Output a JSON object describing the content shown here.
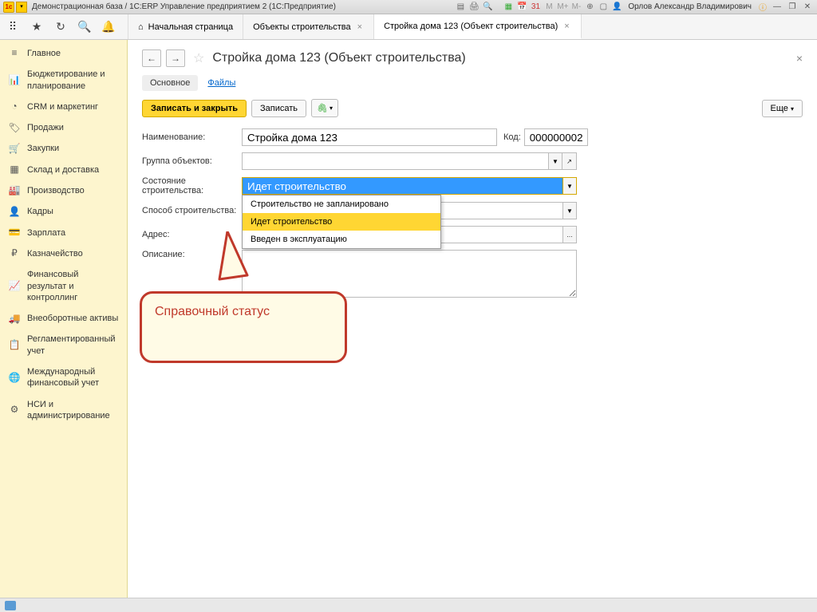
{
  "titlebar": {
    "title": "Демонстрационная база / 1С:ERP Управление предприятием 2  (1С:Предприятие)",
    "user": "Орлов Александр Владимирович"
  },
  "tabs": {
    "home": "Начальная страница",
    "t1": "Объекты строительства",
    "t2": "Стройка дома 123 (Объект строительства)"
  },
  "sidebar": [
    {
      "label": "Главное",
      "icon": "≡"
    },
    {
      "label": "Бюджетирование и планирование",
      "icon": "📊"
    },
    {
      "label": "CRM и маркетинг",
      "icon": "◔"
    },
    {
      "label": "Продажи",
      "icon": "🏷"
    },
    {
      "label": "Закупки",
      "icon": "🛒"
    },
    {
      "label": "Склад и доставка",
      "icon": "▦"
    },
    {
      "label": "Производство",
      "icon": "🏭"
    },
    {
      "label": "Кадры",
      "icon": "👤"
    },
    {
      "label": "Зарплата",
      "icon": "💳"
    },
    {
      "label": "Казначейство",
      "icon": "₽"
    },
    {
      "label": "Финансовый результат и контроллинг",
      "icon": "📈"
    },
    {
      "label": "Внеоборотные активы",
      "icon": "🚚"
    },
    {
      "label": "Регламентированный учет",
      "icon": "📋"
    },
    {
      "label": "Международный финансовый учет",
      "icon": "🌐"
    },
    {
      "label": "НСИ и администрирование",
      "icon": "⚙"
    }
  ],
  "page": {
    "title": "Стройка дома 123 (Объект строительства)",
    "subtab_main": "Основное",
    "subtab_files": "Файлы",
    "btn_save_close": "Записать и закрыть",
    "btn_save": "Записать",
    "btn_more": "Еще"
  },
  "form": {
    "name_label": "Наименование:",
    "name_value": "Стройка дома 123",
    "code_label": "Код:",
    "code_value": "000000002",
    "group_label": "Группа объектов:",
    "group_value": "",
    "state_label": "Состояние строительства:",
    "state_value": "Идет строительство",
    "method_label": "Способ строительства:",
    "method_value": "",
    "address_label": "Адрес:",
    "address_value": "",
    "desc_label": "Описание:"
  },
  "dropdown": {
    "opt1": "Строительство не запланировано",
    "opt2": "Идет строительство",
    "opt3": "Введен в эксплуатацию"
  },
  "callout": "Справочный статус"
}
